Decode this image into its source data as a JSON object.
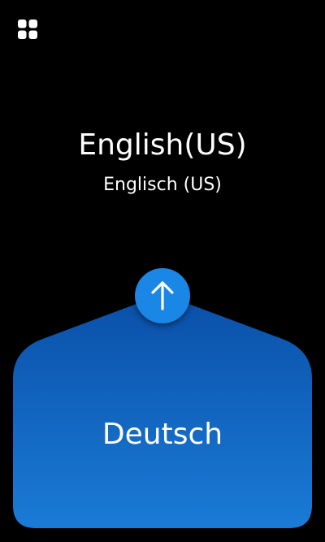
{
  "top": {
    "language": "English(US)",
    "native_name": "Englisch (US)"
  },
  "bottom": {
    "language": "Deutsch"
  },
  "icons": {
    "menu": "grid-icon",
    "swap": "arrow-up-icon"
  },
  "colors": {
    "background": "#000000",
    "panel_top": "#0a4fa8",
    "panel_bottom": "#1a7bd6",
    "swap_button": "#1a86e6",
    "text": "#ffffff"
  }
}
